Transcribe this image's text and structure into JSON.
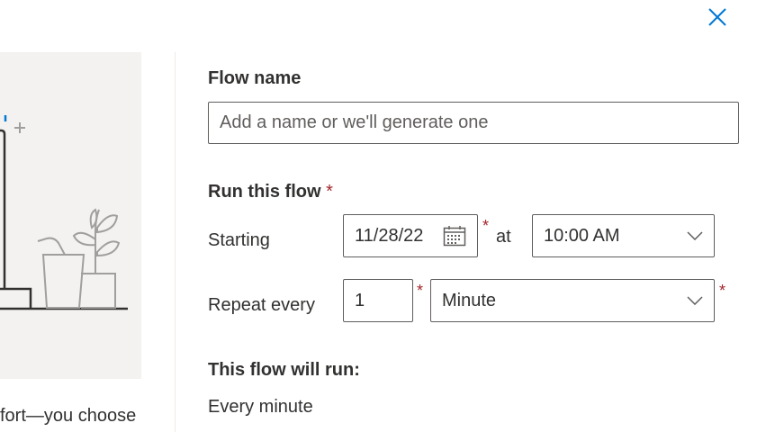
{
  "dialog": {
    "close_icon": "close-icon",
    "caption_text": "fort—you choose"
  },
  "form": {
    "flow_name": {
      "label": "Flow name",
      "placeholder": "Add a name or we'll generate one",
      "value": ""
    },
    "run_this_flow": {
      "label": "Run this flow",
      "required_mark": "*"
    },
    "starting": {
      "label": "Starting",
      "date_value": "11/28/22",
      "date_icon": "calendar-icon",
      "date_required": "*",
      "at_label": "at",
      "time_value": "10:00 AM",
      "time_icon": "chevron-down-icon"
    },
    "repeat": {
      "label": "Repeat every",
      "interval_value": "1",
      "interval_required": "*",
      "unit_value": "Minute",
      "unit_icon": "chevron-down-icon",
      "unit_required": "*"
    },
    "summary": {
      "heading": "This flow will run:",
      "text": "Every minute"
    }
  },
  "colors": {
    "accent": "#0078d4",
    "required": "#a4262c",
    "border": "#605e5c",
    "panel_bg": "#f3f2f1"
  }
}
